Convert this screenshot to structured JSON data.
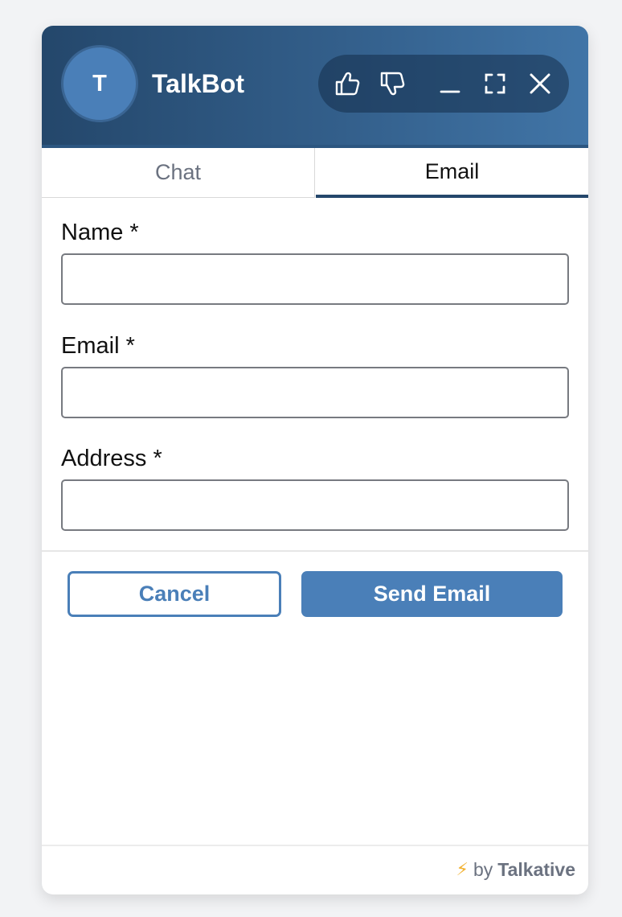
{
  "header": {
    "avatar_initial": "T",
    "bot_name": "TalkBot",
    "icons": [
      "thumbs-up-icon",
      "thumbs-down-icon",
      "minimize-icon",
      "fullscreen-icon",
      "close-icon"
    ]
  },
  "tabs": [
    {
      "label": "Chat",
      "active": false
    },
    {
      "label": "Email",
      "active": true
    }
  ],
  "form": {
    "fields": [
      {
        "label": "Name *",
        "value": "",
        "placeholder": ""
      },
      {
        "label": "Email *",
        "value": "",
        "placeholder": ""
      },
      {
        "label": "Address *",
        "value": "",
        "placeholder": ""
      }
    ],
    "cancel_label": "Cancel",
    "send_label": "Send Email"
  },
  "footer": {
    "icon": "lightning-bolt-icon",
    "by_text": "by",
    "brand": "Talkative"
  },
  "colors": {
    "header_dark": "#24476b",
    "header_light": "#4175a7",
    "accent": "#4a7fb8",
    "bolt": "#f2b233"
  }
}
